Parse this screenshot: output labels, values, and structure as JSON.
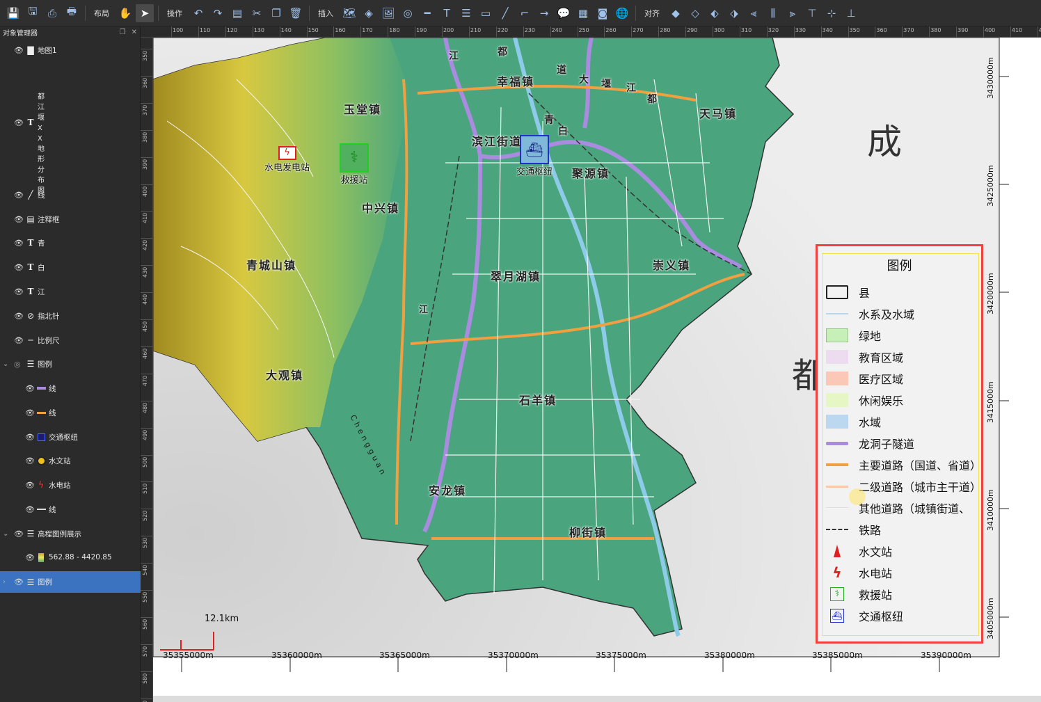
{
  "toolbar": {
    "groups": {
      "layout": "布局",
      "operate": "操作",
      "insert": "插入",
      "align": "对齐"
    }
  },
  "panel": {
    "title": "对象管理器",
    "layers": {
      "map1": "地图1",
      "title_text_vertical": [
        "都",
        "江",
        "堰",
        "X",
        "X",
        "地",
        "形",
        "分",
        "布",
        "图"
      ],
      "line1": "线",
      "note_box": "注释框",
      "t_qing": "青",
      "t_bai": "白",
      "t_jiang": "江",
      "compass": "指北针",
      "scalebar": "比例尺",
      "legend1": "图例",
      "leg_line_purple": "线",
      "leg_line_orange": "线",
      "leg_hub": "交通枢纽",
      "leg_hydro_station": "水文站",
      "leg_power_station": "水电站",
      "leg_line_gray": "线",
      "elev_legend": "高程图例展示",
      "elev_range": "562.88 - 4420.85",
      "legend2": "图例"
    }
  },
  "ruler": {
    "top": [
      "100",
      "110",
      "120",
      "130",
      "140",
      "150",
      "160",
      "170",
      "180",
      "190",
      "200",
      "210",
      "220",
      "230",
      "240",
      "250",
      "260",
      "270",
      "280",
      "290",
      "300",
      "310",
      "320",
      "330",
      "340",
      "350",
      "360",
      "370",
      "380",
      "390",
      "400",
      "410",
      "420"
    ],
    "left": [
      "350",
      "360",
      "370",
      "380",
      "390",
      "400",
      "410",
      "420",
      "430",
      "440",
      "450",
      "460",
      "470",
      "480",
      "490",
      "500",
      "510",
      "520",
      "530",
      "540",
      "550",
      "560",
      "570",
      "580",
      "590"
    ]
  },
  "map": {
    "places": [
      "玉堂镇",
      "天马镇",
      "幸福镇",
      "滨江街道",
      "聚源镇",
      "中兴镇",
      "青城山镇",
      "翠月湖镇",
      "崇义镇",
      "大观镇",
      "石羊镇",
      "安龙镇",
      "柳街镇"
    ],
    "road_labels": [
      "江",
      "都",
      "道",
      "大",
      "堰",
      "江",
      "都",
      "青",
      "白",
      "江"
    ],
    "big_chars": [
      "成",
      "都"
    ],
    "poi": {
      "power": "水电发电站",
      "rescue": "救援站",
      "hub": "交通枢纽"
    },
    "x_coords": [
      "35355000m",
      "35360000m",
      "35365000m",
      "35370000m",
      "35375000m",
      "35380000m",
      "35385000m",
      "35390000m"
    ],
    "y_coords": [
      "3430000m",
      "3425000m",
      "3420000m",
      "3415000m",
      "3410000m",
      "3405000m"
    ],
    "scale": "12.1km",
    "river_label": "Chengguan"
  },
  "legend": {
    "title": "图例",
    "items": [
      "县",
      "水系及水域",
      "绿地",
      "教育区域",
      "医疗区域",
      "休闲娱乐",
      "水域",
      "龙洞子隧道",
      "主要道路（国道、省道）",
      "二级道路（城市主干道）",
      "其他道路（城镇街道、",
      "铁路",
      "水文站",
      "水电站",
      "救援站",
      "交通枢纽"
    ]
  },
  "colors": {
    "accent": "#3b73c0",
    "legend_border": "#f04040",
    "county_fill": "#4aa57e",
    "tunnel": "#a98be0",
    "major_road": "#f0a040"
  }
}
